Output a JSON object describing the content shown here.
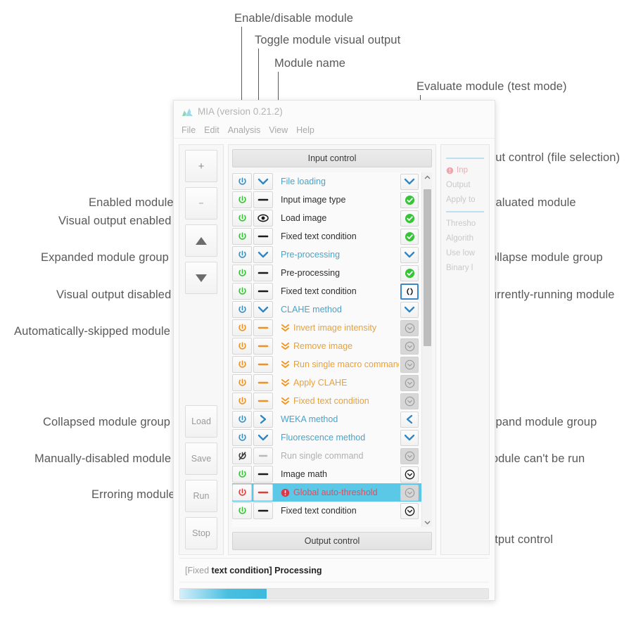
{
  "window": {
    "title": "MIA (version 0.21.2)",
    "logo_icon": "mia-mountain-logo-icon",
    "menu": [
      "File",
      "Edit",
      "Analysis",
      "View",
      "Help"
    ]
  },
  "rail": {
    "buttons": [
      {
        "label": "+",
        "name": "add-module-button",
        "icon": "plus-icon"
      },
      {
        "label": "−",
        "name": "remove-module-button",
        "icon": "minus-icon"
      },
      {
        "label": "",
        "name": "move-module-up-button",
        "icon": "triangle-up-icon"
      },
      {
        "label": "",
        "name": "move-module-down-button",
        "icon": "triangle-down-icon"
      }
    ],
    "bottom_buttons": [
      {
        "label": "Load",
        "name": "load-button"
      },
      {
        "label": "Save",
        "name": "save-button"
      },
      {
        "label": "Run",
        "name": "run-button"
      },
      {
        "label": "Stop",
        "name": "stop-button"
      }
    ]
  },
  "panel": {
    "input_control_label": "Input control",
    "output_control_label": "Output control",
    "scroll_up_icon": "chevron-up-icon",
    "scroll_down_icon": "chevron-down-icon",
    "scroll_thumb_top_pct": 2,
    "scroll_thumb_height_pct": 47
  },
  "modules": [
    {
      "name": "File loading",
      "style": "blue",
      "power": "blue",
      "vis": "chevron-down",
      "eval": "chevron-down",
      "selected": false,
      "skip": false,
      "error": false
    },
    {
      "name": "Input image type",
      "style": "dark",
      "power": "green",
      "vis": "dash-dark",
      "eval": "check-green",
      "selected": false,
      "skip": false,
      "error": false
    },
    {
      "name": "Load image",
      "style": "dark",
      "power": "green",
      "vis": "eye",
      "eval": "check-green",
      "selected": false,
      "skip": false,
      "error": false
    },
    {
      "name": "Fixed text condition",
      "style": "dark",
      "power": "green",
      "vis": "dash-dark",
      "eval": "check-green",
      "selected": false,
      "skip": false,
      "error": false
    },
    {
      "name": "Pre-processing",
      "style": "blue",
      "power": "blue",
      "vis": "chevron-down",
      "eval": "chevron-down",
      "selected": false,
      "skip": false,
      "error": false
    },
    {
      "name": "Pre-processing",
      "style": "dark",
      "power": "green",
      "vis": "dash-dark",
      "eval": "check-green",
      "selected": false,
      "skip": false,
      "error": false
    },
    {
      "name": "Fixed text condition",
      "style": "dark",
      "power": "green",
      "vis": "dash-dark",
      "eval": "running",
      "selected": false,
      "skip": false,
      "error": false
    },
    {
      "name": "CLAHE method",
      "style": "blue",
      "power": "blue",
      "vis": "chevron-down",
      "eval": "chevron-down",
      "selected": false,
      "skip": false,
      "error": false
    },
    {
      "name": "Invert image intensity",
      "style": "orange",
      "power": "orange",
      "vis": "dash-orange",
      "eval": "disabled",
      "selected": false,
      "skip": true,
      "error": false
    },
    {
      "name": "Remove image",
      "style": "orange",
      "power": "orange",
      "vis": "dash-orange",
      "eval": "disabled",
      "selected": false,
      "skip": true,
      "error": false
    },
    {
      "name": "Run single macro command",
      "style": "orange",
      "power": "orange",
      "vis": "dash-orange",
      "eval": "disabled",
      "selected": false,
      "skip": true,
      "error": false
    },
    {
      "name": "Apply CLAHE",
      "style": "orange",
      "power": "orange",
      "vis": "dash-orange",
      "eval": "disabled",
      "selected": false,
      "skip": true,
      "error": false
    },
    {
      "name": "Fixed text condition",
      "style": "orange",
      "power": "orange",
      "vis": "dash-orange",
      "eval": "disabled",
      "selected": false,
      "skip": true,
      "error": false
    },
    {
      "name": "WEKA method",
      "style": "blue",
      "power": "blue",
      "vis": "chevron-right",
      "eval": "chevron-left",
      "selected": false,
      "skip": false,
      "error": false
    },
    {
      "name": "Fluorescence method",
      "style": "blue",
      "power": "blue",
      "vis": "chevron-down",
      "eval": "chevron-down",
      "selected": false,
      "skip": false,
      "error": false
    },
    {
      "name": "Run single command",
      "style": "grey",
      "power": "disabled",
      "vis": "dash-grey",
      "eval": "disabled",
      "selected": false,
      "skip": false,
      "error": false
    },
    {
      "name": "Image math",
      "style": "dark",
      "power": "green",
      "vis": "dash-dark",
      "eval": "circle-chevron",
      "selected": false,
      "skip": false,
      "error": false
    },
    {
      "name": "Global auto-threshold",
      "style": "err",
      "power": "red",
      "vis": "dash-red",
      "eval": "disabled",
      "selected": true,
      "skip": false,
      "error": true
    },
    {
      "name": "Fixed text condition",
      "style": "dark",
      "power": "green",
      "vis": "dash-dark",
      "eval": "circle-chevron",
      "selected": false,
      "skip": false,
      "error": false
    }
  ],
  "params_panel": {
    "lines": [
      {
        "kind": "rule",
        "text": ""
      },
      {
        "kind": "error",
        "text": "Inp"
      },
      {
        "kind": "text",
        "text": "Output "
      },
      {
        "kind": "text",
        "text": "Apply to"
      },
      {
        "kind": "rule",
        "text": ""
      },
      {
        "kind": "text",
        "text": "Thresho"
      },
      {
        "kind": "text",
        "text": "Algorith"
      },
      {
        "kind": "text",
        "text": "Use low"
      },
      {
        "kind": "text",
        "text": "Binary l"
      }
    ]
  },
  "status": {
    "prefix": "[Fixed",
    "suffix": "text condition] Processing",
    "progress_percent": 28
  },
  "annotations": {
    "top": [
      {
        "text": "Enable/disable module",
        "name": "annotation-enable-disable-module"
      },
      {
        "text": "Toggle module visual output",
        "name": "annotation-toggle-visual-output"
      },
      {
        "text": "Module name",
        "name": "annotation-module-name"
      },
      {
        "text": "Evaluate module (test mode)",
        "name": "annotation-evaluate-module"
      }
    ],
    "left": [
      {
        "text": "Enabled module",
        "name": "annotation-enabled-module"
      },
      {
        "text": "Visual output enabled",
        "name": "annotation-visual-output-enabled"
      },
      {
        "text": "Expanded module group",
        "name": "annotation-expanded-module-group"
      },
      {
        "text": "Visual output disabled",
        "name": "annotation-visual-output-disabled"
      },
      {
        "text": "Automatically-skipped module",
        "name": "annotation-auto-skipped-module"
      },
      {
        "text": "Collapsed module group",
        "name": "annotation-collapsed-module-group"
      },
      {
        "text": "Manually-disabled module",
        "name": "annotation-manually-disabled-module"
      },
      {
        "text": "Erroring module",
        "name": "annotation-erroring-module"
      }
    ],
    "right": [
      {
        "text": "Input control (file selection)",
        "name": "annotation-input-control"
      },
      {
        "text": "Evaluated module",
        "name": "annotation-evaluated-module"
      },
      {
        "text": "Collapse module group",
        "name": "annotation-collapse-module-group"
      },
      {
        "text": "Currently-running module",
        "name": "annotation-currently-running-module"
      },
      {
        "text": "Expand module group",
        "name": "annotation-expand-module-group"
      },
      {
        "text": "Module can't be run",
        "name": "annotation-module-cant-be-run"
      },
      {
        "text": "Output control",
        "name": "annotation-output-control"
      }
    ]
  },
  "colors": {
    "blue_text": "#4aa3c8",
    "orange_text": "#e8a13c",
    "error_red": "#dd4f5c",
    "green": "#35c536",
    "selection": "#5bc8e8",
    "progress": "#3cb9de",
    "annotation_grey": "#58595b"
  }
}
